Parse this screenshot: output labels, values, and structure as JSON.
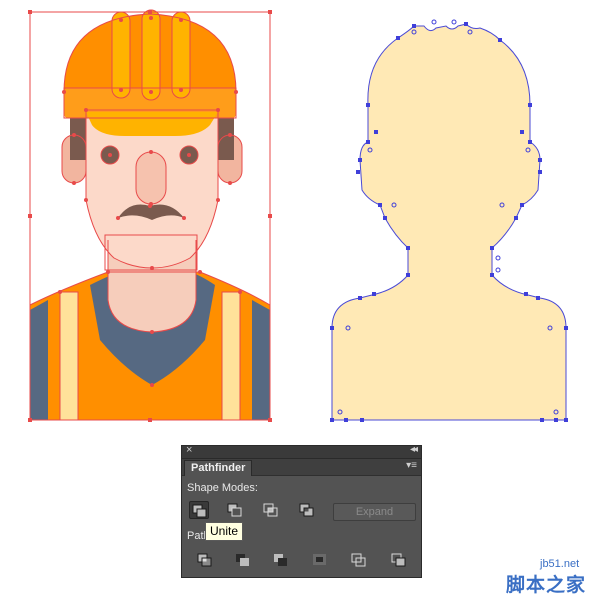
{
  "panel": {
    "close_glyph": "×",
    "collapse_glyph": "◂◂",
    "tab_label": "Pathfinder",
    "menu_glyph": "▾≡",
    "shape_modes_label": "Shape Modes:",
    "pathfinders_label": "Path",
    "expand_label": "Expand",
    "shape_modes": [
      {
        "name": "unite",
        "active": true
      },
      {
        "name": "minus-front",
        "active": false
      },
      {
        "name": "intersect",
        "active": false
      },
      {
        "name": "exclude",
        "active": false
      }
    ],
    "pathfinders": [
      "divide",
      "trim",
      "merge",
      "crop",
      "outline",
      "minus-back"
    ]
  },
  "tooltip": {
    "text": "Unite"
  },
  "watermark": {
    "url": "jb51.net",
    "name": "脚本之家"
  },
  "colors": {
    "helmet": "#ff8f00",
    "helmet_stripe": "#ffb300",
    "skin": "#fcd9c9",
    "skin_shadow": "#f2b59f",
    "hair": "#7a5a4e",
    "vest": "#ff8f00",
    "vest_stripe": "#ffe29a",
    "shirt": "#566982",
    "selection": "#e84a4a",
    "unite_fill": "#ffe9b5",
    "unite_stroke": "#4a4ad6",
    "panel_bg": "#535353"
  }
}
